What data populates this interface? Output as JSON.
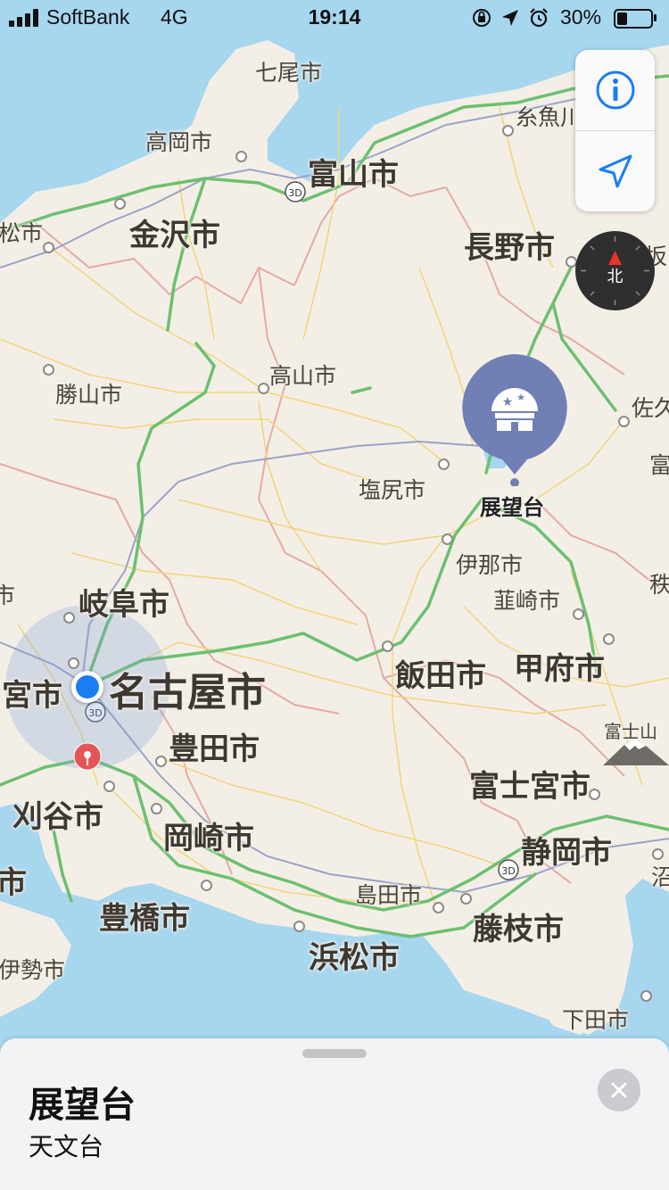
{
  "status_bar": {
    "carrier": "SoftBank",
    "network": "4G",
    "time": "19:14",
    "battery_percent": "30%",
    "battery_level": 0.3
  },
  "map": {
    "colors": {
      "land": "#f4efe6",
      "water": "#a7d6ef",
      "highway": "#6cc070",
      "road": "#f3d77a",
      "border": "#e0a7a0"
    },
    "city_labels": [
      "七尾市",
      "高岡市",
      "富山市",
      "糸魚川",
      "松市",
      "金沢市",
      "長野市",
      "須坂",
      "高山市",
      "勝山市",
      "佐久",
      "塩尻市",
      "伊那市",
      "韮崎市",
      "岐阜市",
      "市",
      "名古屋市",
      "宮市",
      "甲府市",
      "飯田市",
      "豊田市",
      "富士山",
      "富士宮市",
      "刈谷市",
      "岡崎市",
      "静岡市",
      "豊橋市",
      "島田市",
      "藤枝市",
      "浜松市",
      "伊勢市",
      "下田市",
      "市",
      "富",
      "秩",
      "沼"
    ],
    "badge_3d": "3D"
  },
  "controls": {
    "info_icon": "info-icon",
    "location_icon": "location-arrow-icon",
    "compass_label": "北"
  },
  "poi": {
    "label": "展望台",
    "icon": "observatory-icon",
    "color": "#7180b4"
  },
  "sheet": {
    "title": "展望台",
    "subtitle": "天文台"
  }
}
